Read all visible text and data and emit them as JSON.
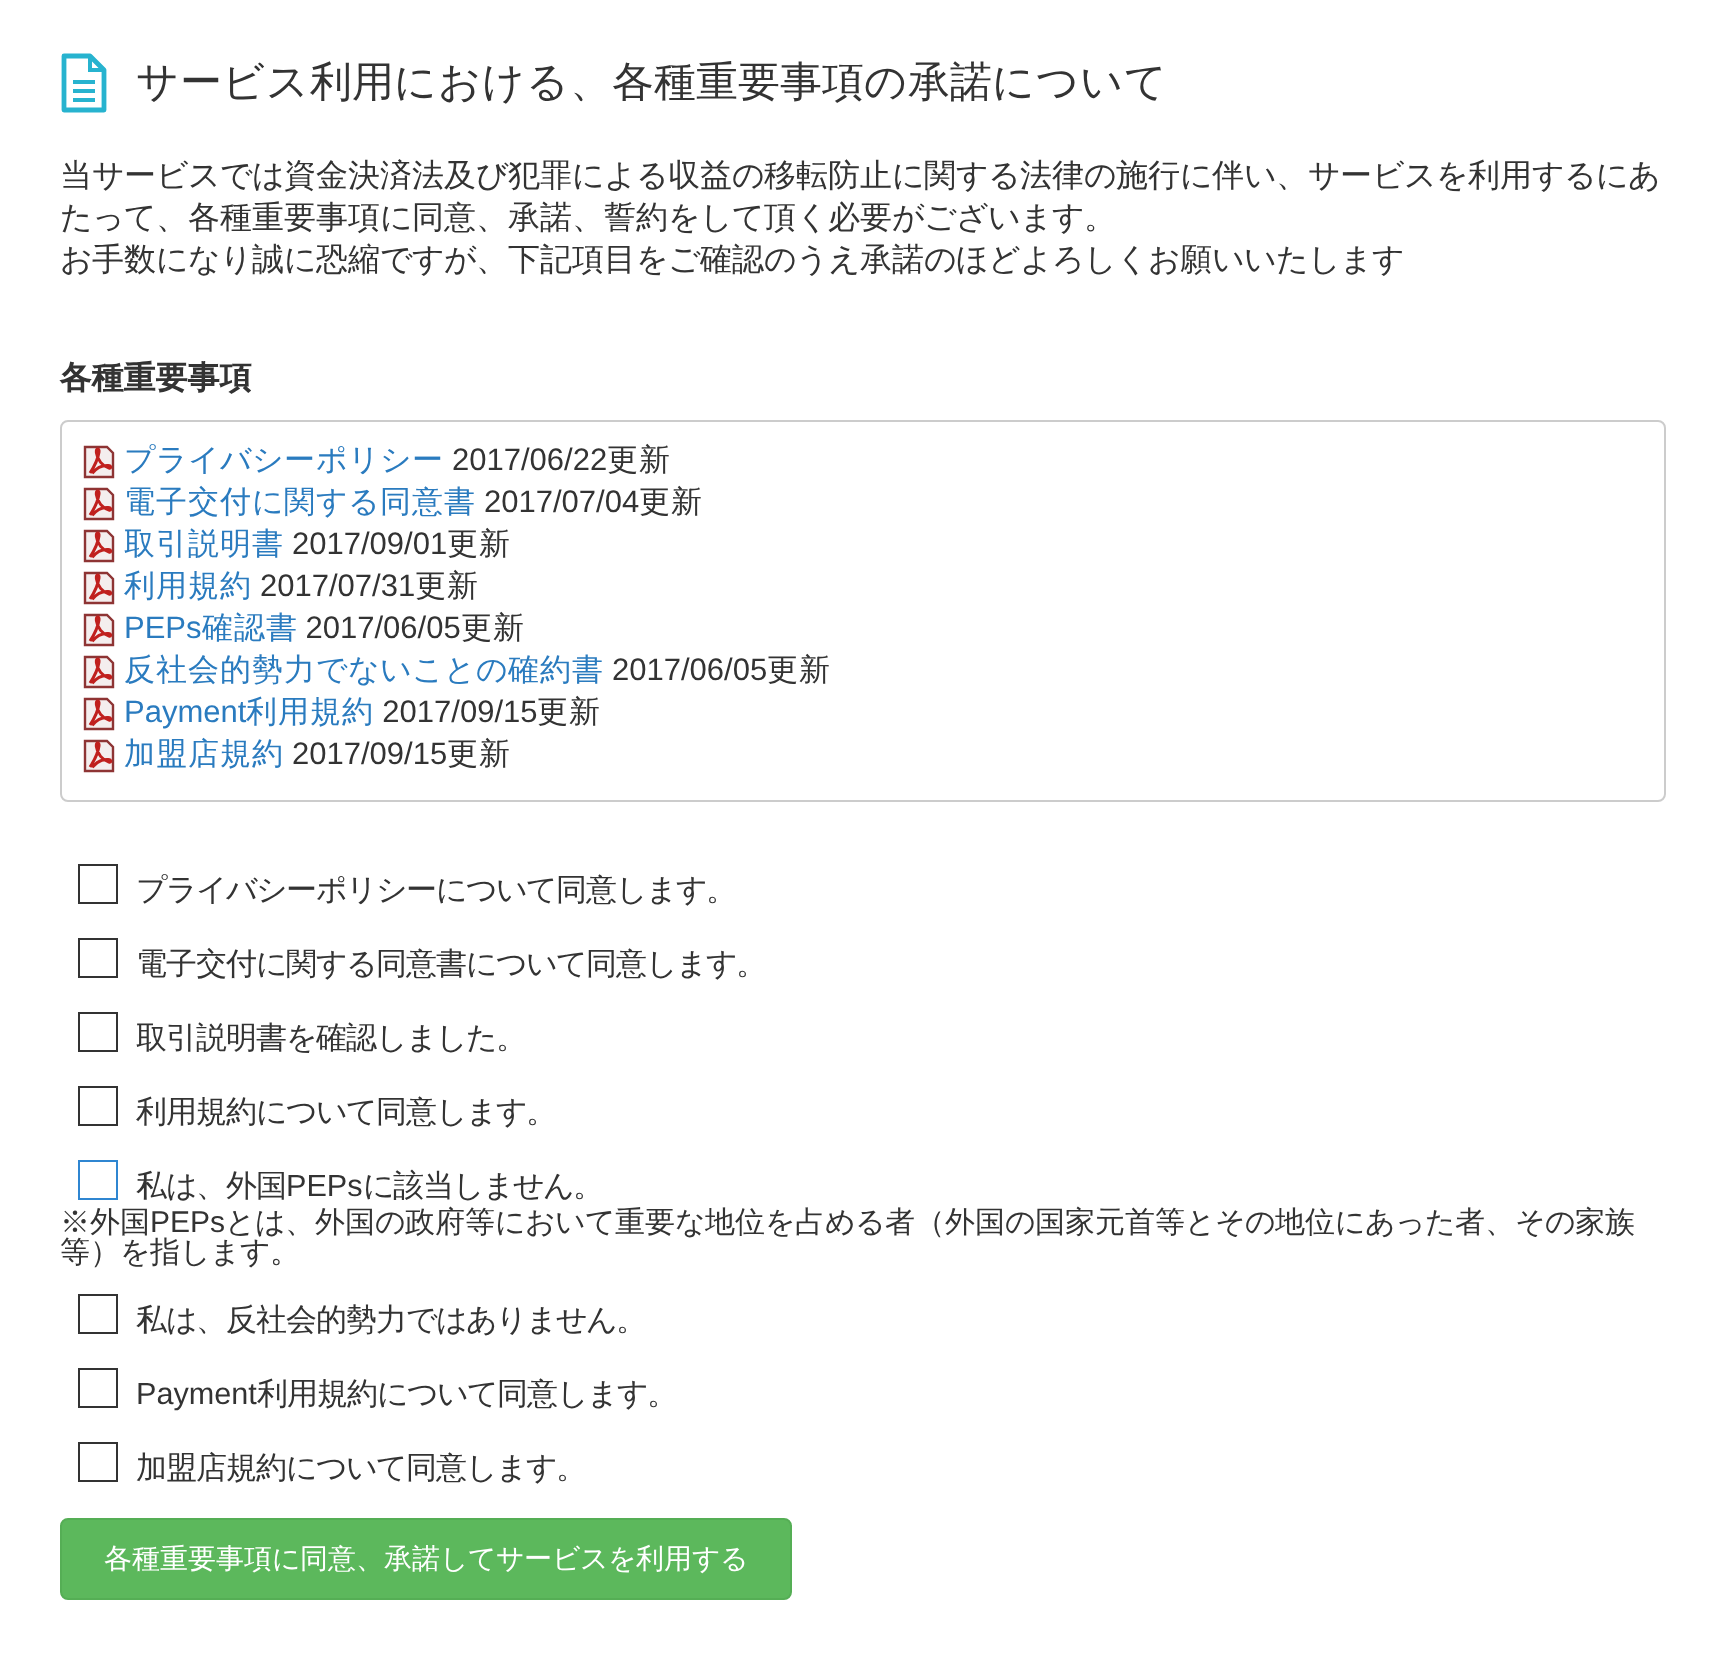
{
  "header": {
    "title": "サービス利用における、各種重要事項の承諾について"
  },
  "intro": [
    "当サービスでは資金決済法及び犯罪による収益の移転防止に関する法律の施行に伴い、サービスを利用するにあたって、各種重要事項に同意、承諾、誓約をして頂く必要がございます。",
    "お手数になり誠に恐縮ですが、下記項目をご確認のうえ承諾のほどよろしくお願いいたします"
  ],
  "documents": {
    "heading": "各種重要事項",
    "items": [
      {
        "title": "プライバシーポリシー",
        "updated": "2017/06/22更新"
      },
      {
        "title": "電子交付に関する同意書",
        "updated": "2017/07/04更新"
      },
      {
        "title": "取引説明書",
        "updated": "2017/09/01更新"
      },
      {
        "title": "利用規約",
        "updated": "2017/07/31更新"
      },
      {
        "title": "PEPs確認書",
        "updated": "2017/06/05更新"
      },
      {
        "title": "反社会的勢力でないことの確約書",
        "updated": "2017/06/05更新"
      },
      {
        "title": "Payment利用規約",
        "updated": "2017/09/15更新"
      },
      {
        "title": "加盟店規約",
        "updated": "2017/09/15更新"
      }
    ]
  },
  "agreements": [
    {
      "label": "プライバシーポリシーについて同意します。",
      "checked": false,
      "focused": false
    },
    {
      "label": "電子交付に関する同意書について同意します。",
      "checked": false,
      "focused": false
    },
    {
      "label": "取引説明書を確認しました。",
      "checked": false,
      "focused": false
    },
    {
      "label": "利用規約について同意します。",
      "checked": false,
      "focused": false
    },
    {
      "label": "私は、外国PEPsに該当しません。",
      "checked": false,
      "focused": true,
      "note": "※外国PEPsとは、外国の政府等において重要な地位を占める者（外国の国家元首等とその地位にあった者、その家族等）を指します。"
    },
    {
      "label": "私は、反社会的勢力ではありません。",
      "checked": false,
      "focused": false
    },
    {
      "label": "Payment利用規約について同意します。",
      "checked": false,
      "focused": false
    },
    {
      "label": "加盟店規約について同意します。",
      "checked": false,
      "focused": false
    }
  ],
  "submit_button": {
    "label": "各種重要事項に同意、承諾してサービスを利用する"
  }
}
